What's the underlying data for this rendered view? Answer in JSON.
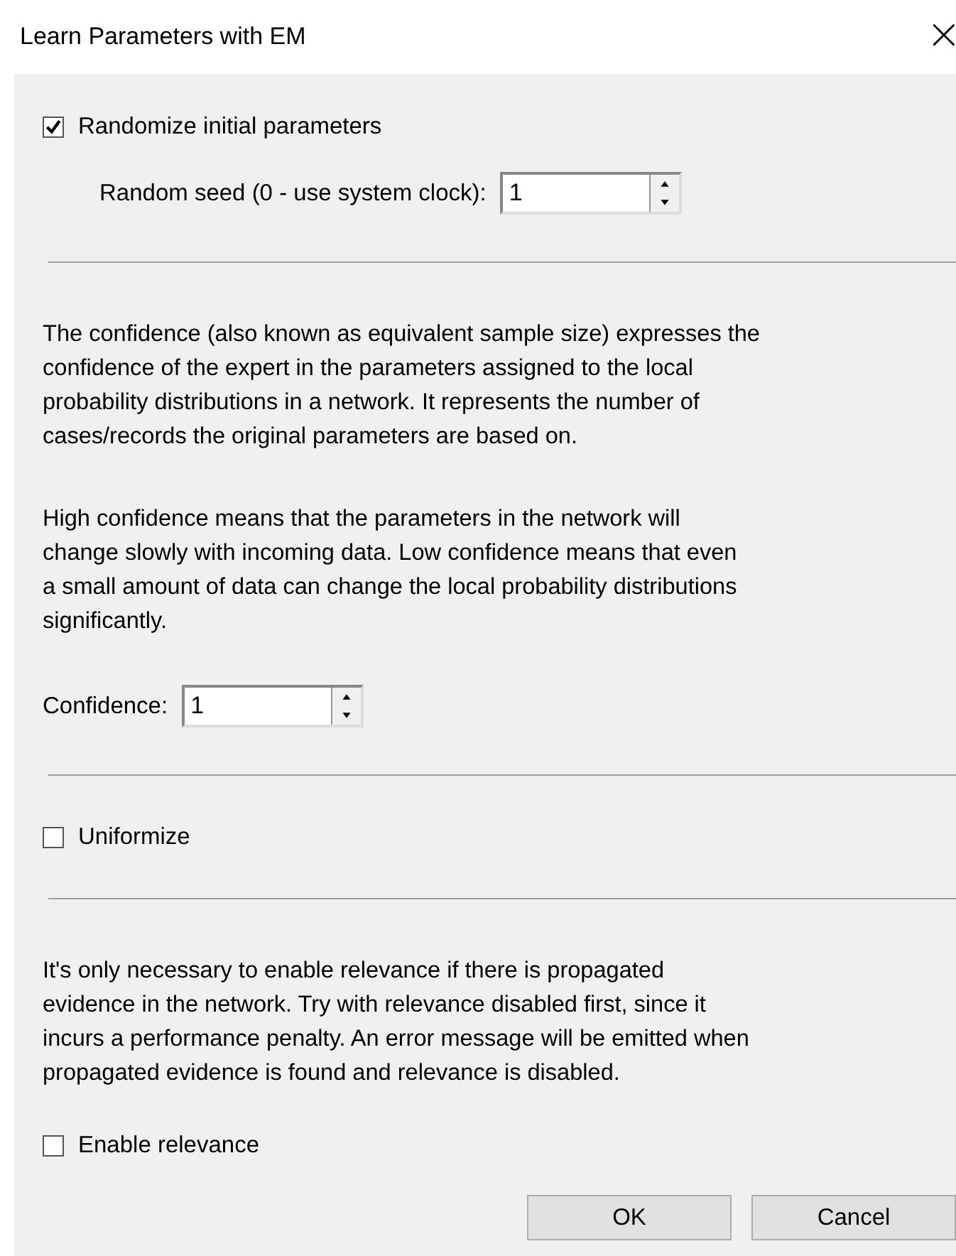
{
  "window": {
    "title": "Learn Parameters with EM",
    "close": "×"
  },
  "sections": [
    {
      "kind": "checkbox",
      "label": "Randomize initial parameters",
      "checked": true
    },
    {
      "kind": "spin",
      "label": "Random seed (0 - use system clock):",
      "value": "1",
      "indent": true
    },
    {
      "kind": "divider"
    },
    {
      "kind": "text",
      "text": "The confidence (also known as equivalent sample size) expresses the\nconfidence of the expert in the parameters assigned to the local\nprobability distributions in a network. It represents the number of\ncases/records the original parameters are based on."
    },
    {
      "kind": "text",
      "text": "High confidence means that the parameters in the network will\nchange slowly with incoming data. Low confidence means that even\na small amount of data can change the local probability distributions\nsignificantly."
    },
    {
      "kind": "spin",
      "label": "Confidence:",
      "value": "1",
      "indent": false
    },
    {
      "kind": "divider"
    },
    {
      "kind": "checkbox",
      "label": "Uniformize",
      "checked": false
    },
    {
      "kind": "divider"
    },
    {
      "kind": "text",
      "text": "It's only necessary to enable relevance if there is propagated\nevidence in the network. Try with relevance disabled first, since it\nincurs a performance penalty. An error message will be emitted when\npropagated evidence is found and relevance is disabled."
    },
    {
      "kind": "checkbox",
      "label": "Enable relevance",
      "checked": false
    }
  ],
  "buttons": [
    "OK",
    "Cancel"
  ]
}
